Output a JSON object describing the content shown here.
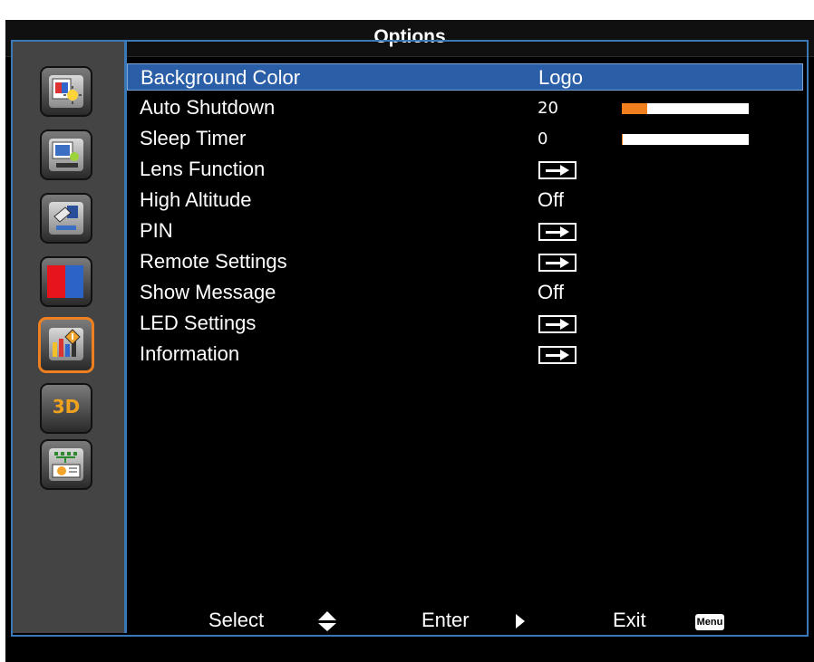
{
  "window": {
    "title": "Options"
  },
  "sidebar": {
    "items": [
      {
        "icon": "image-settings-icon"
      },
      {
        "icon": "display-settings-icon"
      },
      {
        "icon": "setup-icon"
      },
      {
        "icon": "color-settings-icon"
      },
      {
        "icon": "options-icon",
        "active": true
      },
      {
        "icon": "3d-icon",
        "label": "3D"
      },
      {
        "icon": "network-icon"
      }
    ]
  },
  "menu": {
    "items": [
      {
        "label": "Background Color",
        "value": "Logo",
        "type": "text",
        "selected": true
      },
      {
        "label": "Auto Shutdown",
        "value": "20",
        "type": "slider",
        "level": 0.2
      },
      {
        "label": "Sleep Timer",
        "value": "0",
        "type": "slider",
        "level": 0.01
      },
      {
        "label": "Lens Function",
        "value": "",
        "type": "submenu"
      },
      {
        "label": "High Altitude",
        "value": "Off",
        "type": "text"
      },
      {
        "label": "PIN",
        "value": "",
        "type": "submenu"
      },
      {
        "label": "Remote Settings",
        "value": "",
        "type": "submenu"
      },
      {
        "label": "Show Message",
        "value": "Off",
        "type": "text"
      },
      {
        "label": "LED Settings",
        "value": "",
        "type": "submenu"
      },
      {
        "label": "Information",
        "value": "",
        "type": "submenu"
      }
    ]
  },
  "footer": {
    "select_label": "Select",
    "enter_label": "Enter",
    "exit_label": "Exit",
    "menu_key_label": "Menu"
  },
  "colors": {
    "accent_blue": "#2a5ea6",
    "slider_fill": "#f07f1e",
    "active_border": "#f0801f"
  }
}
